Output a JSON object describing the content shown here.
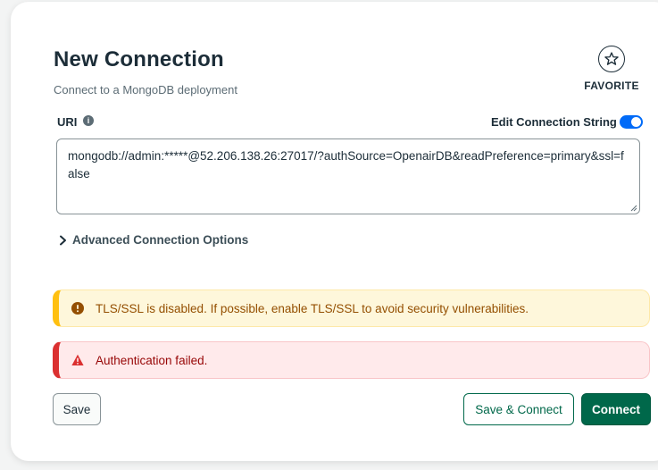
{
  "header": {
    "title": "New Connection",
    "subtitle": "Connect to a MongoDB deployment",
    "favorite_label": "FAVORITE"
  },
  "uri": {
    "label": "URI",
    "edit_connection_string_label": "Edit Connection String",
    "edit_toggle_on": true,
    "value": "mongodb://admin:*****@52.206.138.26:27017/?authSource=OpenairDB&readPreference=primary&ssl=false"
  },
  "advanced": {
    "label": "Advanced Connection Options"
  },
  "banners": {
    "warning": "TLS/SSL is disabled. If possible, enable TLS/SSL to avoid security vulnerabilities.",
    "error": "Authentication failed."
  },
  "buttons": {
    "save": "Save",
    "save_connect": "Save & Connect",
    "connect": "Connect"
  },
  "colors": {
    "primary_green": "#00684a",
    "toggle_blue": "#016bf8",
    "warning_accent": "#ffc010",
    "error_accent": "#db3030"
  },
  "icons": {
    "favorite": "star-icon",
    "info": "info-icon",
    "advanced": "chevron-right-icon",
    "warning": "exclamation-circle-icon",
    "error": "warning-triangle-icon"
  }
}
